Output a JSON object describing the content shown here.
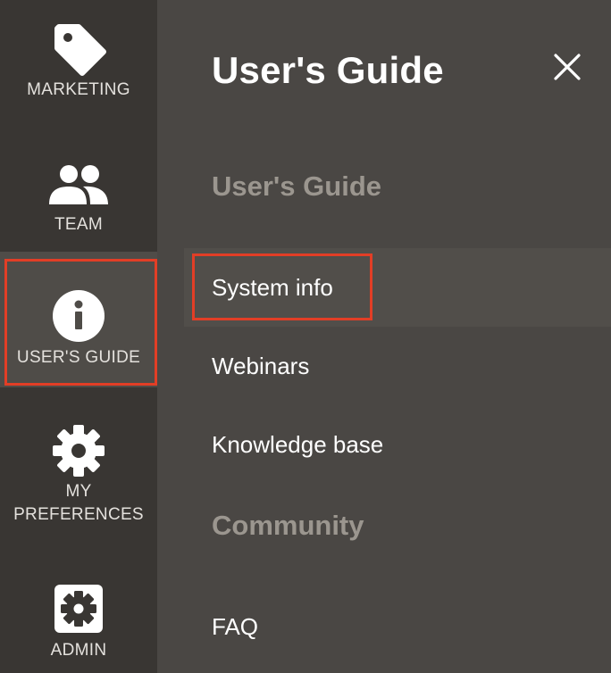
{
  "sidebar": {
    "items": [
      {
        "label": "MARKETING",
        "icon": "tag-icon"
      },
      {
        "label": "TEAM",
        "icon": "team-icon"
      },
      {
        "label": "USER'S GUIDE",
        "icon": "info-icon",
        "active": true
      },
      {
        "label_line1": "MY",
        "label_line2": "PREFERENCES",
        "icon": "gear-icon"
      },
      {
        "label": "ADMIN",
        "icon": "admin-gear-icon"
      }
    ]
  },
  "panel": {
    "title": "User's Guide",
    "close_icon": "close-icon",
    "sections": [
      {
        "heading": "User's Guide",
        "items": [
          "System info",
          "Webinars",
          "Knowledge base"
        ]
      },
      {
        "heading": "Community",
        "items": [
          "FAQ"
        ]
      }
    ],
    "selected_item": "System info"
  },
  "colors": {
    "rail_bg": "#393633",
    "panel_bg": "#4a4744",
    "highlight": "#e23e26",
    "section_heading": "#9b968f"
  }
}
